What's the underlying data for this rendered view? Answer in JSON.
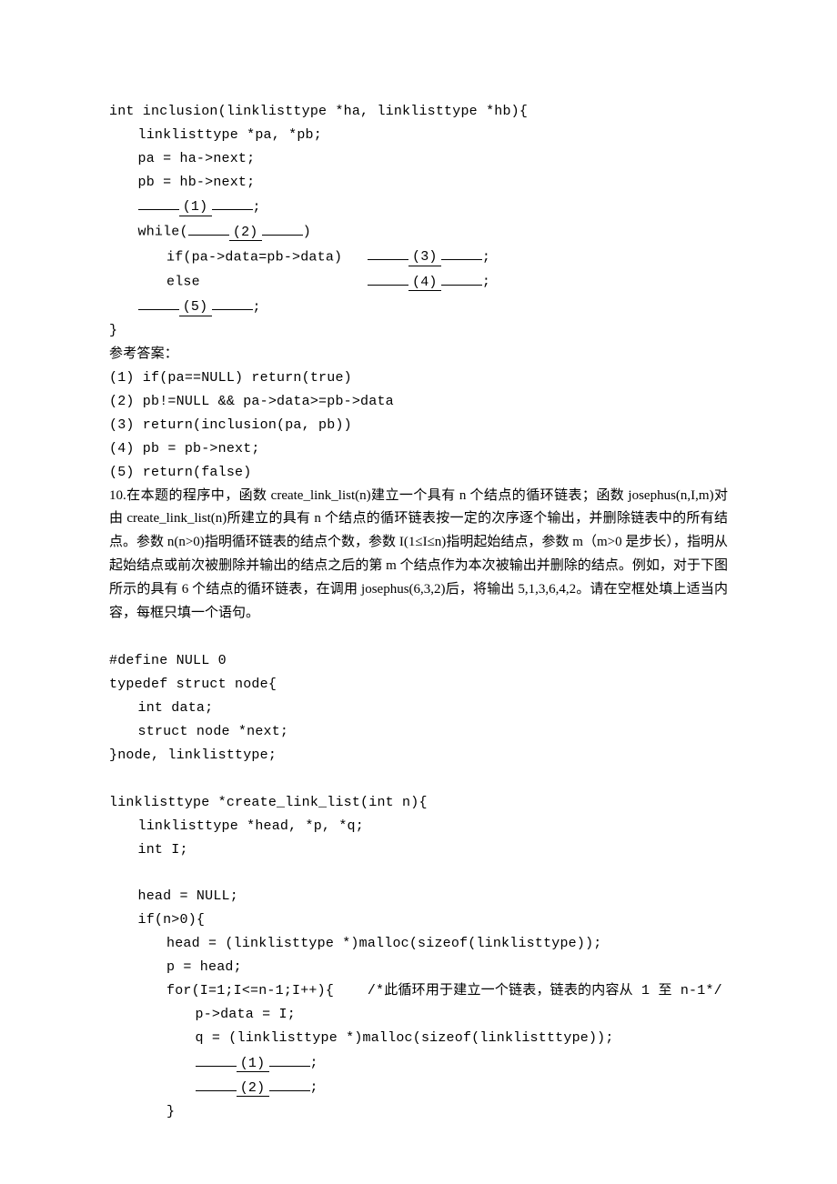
{
  "block1": {
    "l1": "int inclusion(linklisttype *ha, linklisttype *hb){",
    "l2": "linklisttype *pa, *pb;",
    "l3": "pa = ha->next;",
    "l4": "pb = hb->next;",
    "blank1_num": "(1)",
    "l5_suffix": ";",
    "l6_prefix": "while(",
    "blank2_num": "(2)",
    "l6_suffix": ")",
    "l7_prefix": "if(pa->data=pb->data)   ",
    "blank3_num": "(3)",
    "l7_suffix": ";",
    "l8_prefix": "else                    ",
    "blank4_num": "(4)",
    "l8_suffix": ";",
    "blank5_num": "(5)",
    "l9_suffix": ";",
    "l10": "}"
  },
  "answers": {
    "title": "参考答案：",
    "a1": "(1) if(pa==NULL) return(true)",
    "a2": "(2) pb!=NULL && pa->data>=pb->data",
    "a3": "(3) return(inclusion(pa, pb))",
    "a4": "(4) pb = pb->next;",
    "a5": "(5) return(false)"
  },
  "q10": {
    "text": "10.在本题的程序中，函数 create_link_list(n)建立一个具有 n 个结点的循环链表；函数 josephus(n,I,m)对由 create_link_list(n)所建立的具有 n 个结点的循环链表按一定的次序逐个输出，并删除链表中的所有结点。参数 n(n>0)指明循环链表的结点个数，参数 I(1≤I≤n)指明起始结点，参数 m（m>0 是步长），指明从起始结点或前次被删除并输出的结点之后的第 m 个结点作为本次被输出并删除的结点。例如，对于下图所示的具有 6 个结点的循环链表，在调用 josephus(6,3,2)后，将输出 5,1,3,6,4,2。请在空框处填上适当内容，每框只填一个语句。"
  },
  "block2": {
    "l1": "#define NULL 0",
    "l2": "typedef struct node{",
    "l3": "int data;",
    "l4": "struct node *next;",
    "l5": "}node, linklisttype;",
    "l6": "linklisttype *create_link_list(int n){",
    "l7": "linklisttype *head, *p, *q;",
    "l8": "int I;",
    "l9": "head = NULL;",
    "l10": "if(n>0){",
    "l11": "head = (linklisttype *)malloc(sizeof(linklisttype));",
    "l12": "p = head;",
    "l13_prefix": "for(I=1;I<=n-1;I++){    ",
    "l13_comment": "/*此循环用于建立一个链表，链表的内容从 1 至 n-1*/",
    "l14": "p->data = I;",
    "l15": "q = (linklisttype *)malloc(sizeof(linklistttype));",
    "blank1_num": "(1)",
    "l16_suffix": ";",
    "blank2_num": "(2)",
    "l17_suffix": ";",
    "l18": "}"
  }
}
